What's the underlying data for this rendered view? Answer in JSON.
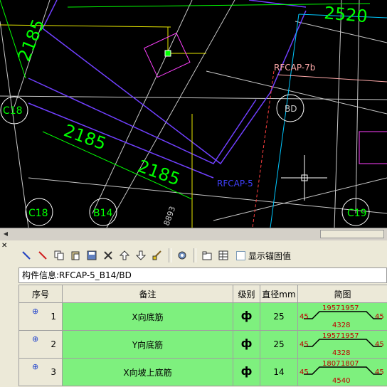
{
  "cad": {
    "dims": [
      "2520",
      "2185",
      "2185",
      "2185"
    ],
    "columns": [
      "C18",
      "BD",
      "C18",
      "B14",
      "C19"
    ],
    "labels": [
      "RFCAP-7b",
      "RFCAP-5",
      "8893"
    ]
  },
  "panel": {
    "show_anchor_label": "显示锚固值",
    "info_label": "构件信息:RFCAP-5_B14/BD",
    "columns": [
      "序号",
      "备注",
      "级别",
      "直径mm",
      "简图"
    ],
    "rows": [
      {
        "no": "1",
        "note": "X向底筋",
        "grade": "ф",
        "dia": "25",
        "s_top": "1957",
        "s_top2": "1957",
        "s_mid": "4328",
        "s_left": "45",
        "s_right": "45"
      },
      {
        "no": "2",
        "note": "Y向底筋",
        "grade": "ф",
        "dia": "25",
        "s_top": "1957",
        "s_top2": "1957",
        "s_mid": "4328",
        "s_left": "45",
        "s_right": "45"
      },
      {
        "no": "3",
        "note": "X向坡上底筋",
        "grade": "ф",
        "dia": "14",
        "s_top": "1807",
        "s_top2": "1807",
        "s_mid": "4540",
        "s_left": "45",
        "s_right": "45"
      }
    ]
  },
  "colors": {
    "green_cell": "#7ef07e",
    "cad_bg": "#000000",
    "dim_green": "#00ff00",
    "label_pink": "#ffaaaa",
    "label_blue": "#4040ff"
  }
}
